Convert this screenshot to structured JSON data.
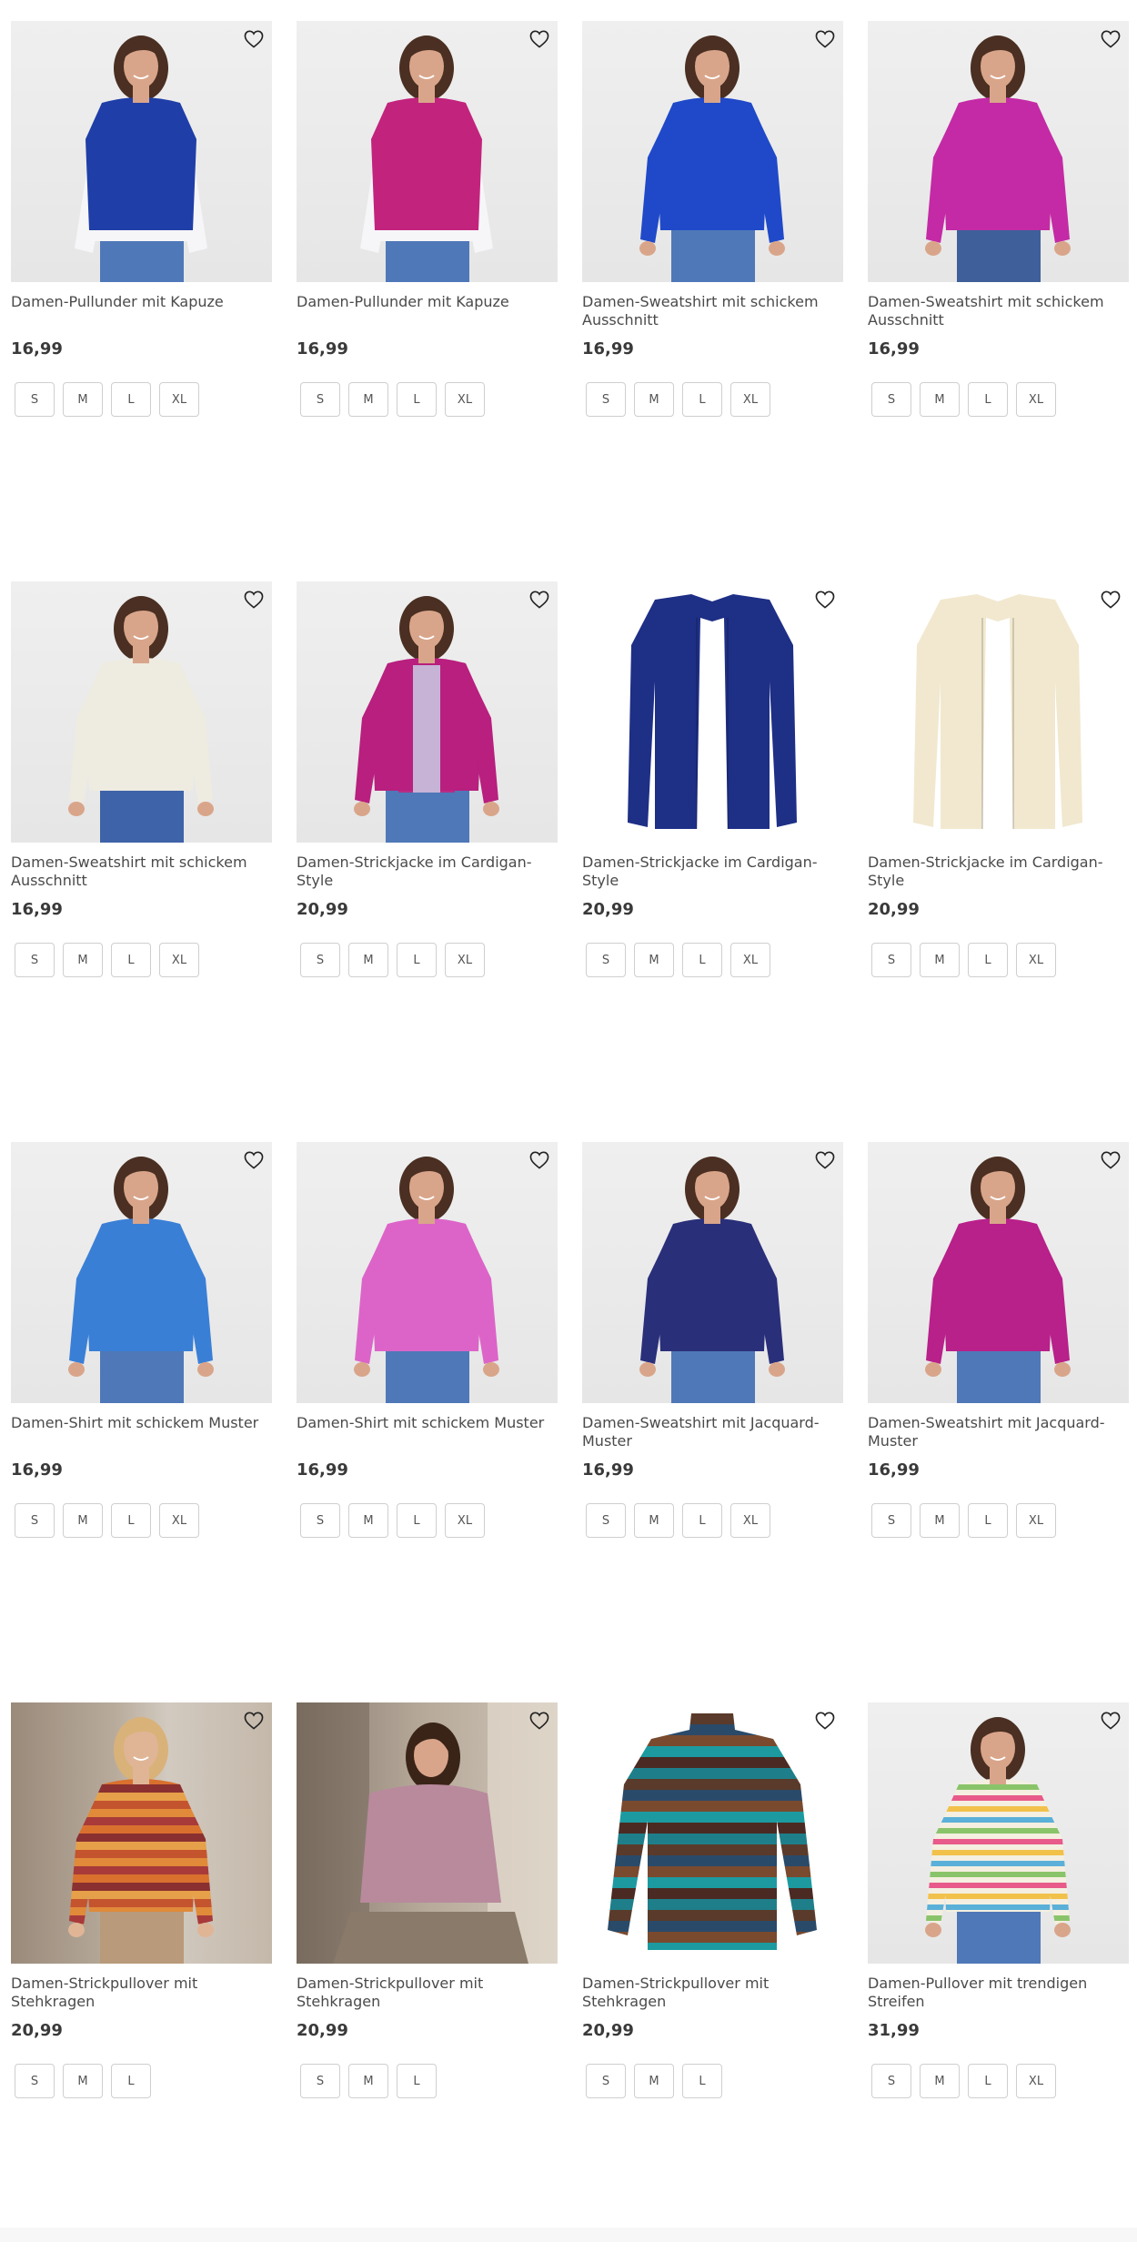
{
  "products": [
    {
      "title": "Damen-Pullunder mit Kapuze",
      "price": "16,99",
      "sizes": [
        "S",
        "M",
        "L",
        "XL"
      ],
      "bg": "studio",
      "color": "#1f3ea8",
      "skin": "#d9a58a",
      "hair": "#4a2f22",
      "style": "vest",
      "pants": "#4f78b8"
    },
    {
      "title": "Damen-Pullunder mit Kapuze",
      "price": "16,99",
      "sizes": [
        "S",
        "M",
        "L",
        "XL"
      ],
      "bg": "studio",
      "color": "#c2237d",
      "skin": "#d9a58a",
      "hair": "#4a2f22",
      "style": "vest",
      "pants": "#4f78b8"
    },
    {
      "title": "Damen-Sweatshirt mit schickem Ausschnitt",
      "price": "16,99",
      "sizes": [
        "S",
        "M",
        "L",
        "XL"
      ],
      "bg": "studio",
      "color": "#1f49c9",
      "skin": "#d9a58a",
      "hair": "#4a2f22",
      "style": "sweat",
      "pants": "#4f78b8"
    },
    {
      "title": "Damen-Sweatshirt mit schickem Ausschnitt",
      "price": "16,99",
      "sizes": [
        "S",
        "M",
        "L",
        "XL"
      ],
      "bg": "studio",
      "color": "#c42aa5",
      "skin": "#d9a58a",
      "hair": "#4a2f22",
      "style": "sweat",
      "pants": "#3f5f9a"
    },
    {
      "title": "Damen-Sweatshirt mit schickem Ausschnitt",
      "price": "16,99",
      "sizes": [
        "S",
        "M",
        "L",
        "XL"
      ],
      "bg": "studio",
      "color": "#eeebe1",
      "skin": "#d9a58a",
      "hair": "#4a2f22",
      "style": "sweat",
      "pants": "#3f63a8"
    },
    {
      "title": "Damen-Strickjacke im Cardigan-Style",
      "price": "20,99",
      "sizes": [
        "S",
        "M",
        "L",
        "XL"
      ],
      "bg": "studio",
      "color": "#b81f7e",
      "skin": "#d9a58a",
      "hair": "#4a2f22",
      "style": "cardigan-model",
      "pants": "#4f78b8"
    },
    {
      "title": "Damen-Strickjacke im Cardigan-Style",
      "price": "20,99",
      "sizes": [
        "S",
        "M",
        "L",
        "XL"
      ],
      "bg": "white",
      "color": "#1e2f86",
      "style": "cardigan-flat"
    },
    {
      "title": "Damen-Strickjacke im Cardigan-Style",
      "price": "20,99",
      "sizes": [
        "S",
        "M",
        "L",
        "XL"
      ],
      "bg": "white",
      "color": "#f1e8cf",
      "style": "cardigan-flat"
    },
    {
      "title": "Damen-Shirt mit schickem Muster",
      "price": "16,99",
      "sizes": [
        "S",
        "M",
        "L",
        "XL"
      ],
      "bg": "studio",
      "color": "#3a7fd6",
      "skin": "#d9a58a",
      "hair": "#4a2f22",
      "style": "sweat",
      "pants": "#4f78b8"
    },
    {
      "title": "Damen-Shirt mit schickem Muster",
      "price": "16,99",
      "sizes": [
        "S",
        "M",
        "L",
        "XL"
      ],
      "bg": "studio",
      "color": "#dc64c8",
      "skin": "#d9a58a",
      "hair": "#4a2f22",
      "style": "sweat",
      "pants": "#4f78b8"
    },
    {
      "title": "Damen-Sweatshirt mit Jacquard-Muster",
      "price": "16,99",
      "sizes": [
        "S",
        "M",
        "L",
        "XL"
      ],
      "bg": "studio",
      "color": "#2a2f7a",
      "skin": "#d9a58a",
      "hair": "#4a2f22",
      "style": "sweat",
      "pants": "#4f78b8"
    },
    {
      "title": "Damen-Sweatshirt mit Jacquard-Muster",
      "price": "16,99",
      "sizes": [
        "S",
        "M",
        "L",
        "XL"
      ],
      "bg": "studio",
      "color": "#b8208a",
      "skin": "#d9a58a",
      "hair": "#4a2f22",
      "style": "sweat",
      "pants": "#4f78b8"
    },
    {
      "title": "Damen-Strickpullover mit Stehkragen",
      "price": "20,99",
      "sizes": [
        "S",
        "M",
        "L"
      ],
      "bg": "outdoor1",
      "color": "#c4542e",
      "skin": "#e0b596",
      "hair": "#d9b27a",
      "style": "stripes-model",
      "pants": "#b99a7a"
    },
    {
      "title": "Damen-Strickpullover mit Stehkragen",
      "price": "20,99",
      "sizes": [
        "S",
        "M",
        "L"
      ],
      "bg": "outdoor2",
      "color": "#b88a9c",
      "skin": "#d9a58a",
      "hair": "#3a2418",
      "style": "seated",
      "pants": "#8a7a6a"
    },
    {
      "title": "Damen-Strickpullover mit Stehkragen",
      "price": "20,99",
      "sizes": [
        "S",
        "M",
        "L"
      ],
      "bg": "white",
      "color": "#1e7f8a",
      "style": "stripes-flat"
    },
    {
      "title": "Damen-Pullover mit trendigen Streifen",
      "price": "31,99",
      "sizes": [
        "S",
        "M",
        "L",
        "XL"
      ],
      "bg": "studio",
      "color": "#f4efe0",
      "skin": "#d9a58a",
      "hair": "#4a2f22",
      "style": "rainbow",
      "pants": "#4f78b8"
    }
  ]
}
